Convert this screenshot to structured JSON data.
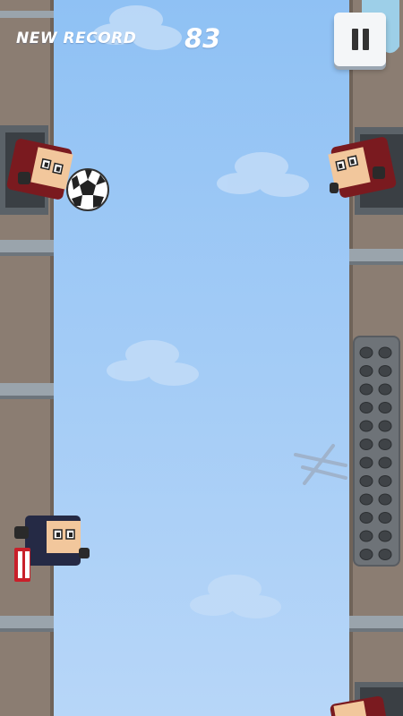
{
  "hud": {
    "record_label": "NEW RECORD",
    "score": "83"
  },
  "pause_icon": "pause-icon",
  "colors": {
    "sky": "#a9cdf7",
    "wall": "#8b7d72",
    "red_team": "#7a1a1f",
    "navy_team": "#252a45",
    "skin": "#f2c79c"
  }
}
